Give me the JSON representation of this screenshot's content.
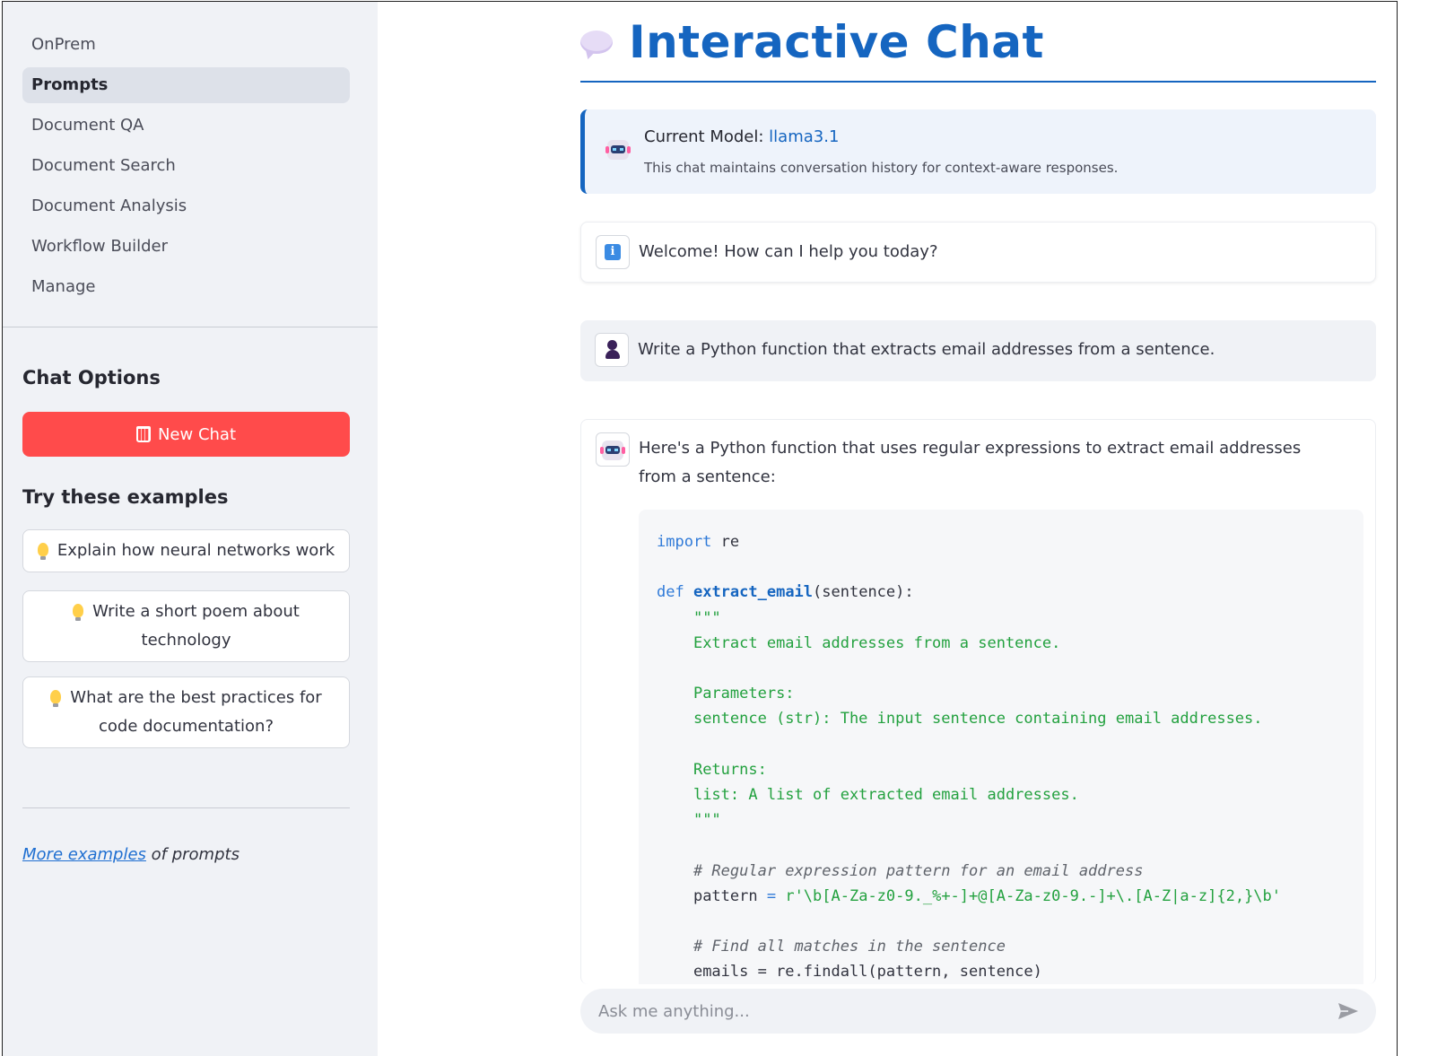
{
  "sidebar": {
    "nav": [
      {
        "label": "OnPrem",
        "active": false
      },
      {
        "label": "Prompts",
        "active": true
      },
      {
        "label": "Document QA",
        "active": false
      },
      {
        "label": "Document Search",
        "active": false
      },
      {
        "label": "Document Analysis",
        "active": false
      },
      {
        "label": "Workflow Builder",
        "active": false
      },
      {
        "label": "Manage",
        "active": false
      }
    ],
    "chat_options_heading": "Chat Options",
    "new_chat_label": "New Chat",
    "examples_heading": "Try these examples",
    "examples": [
      "Explain how neural networks work",
      "Write a short poem about technology",
      "What are the best practices for code documentation?"
    ],
    "more_link": "More examples",
    "more_suffix": " of prompts"
  },
  "main": {
    "title": "Interactive Chat",
    "model_label": "Current Model: ",
    "model_name": "llama3.1",
    "model_subtitle": "This chat maintains conversation history for context-aware responses.",
    "messages": {
      "welcome": "Welcome! How can I help you today?",
      "user": "Write a Python function that extracts email addresses from a sentence.",
      "assistant": "Here's a Python function that uses regular expressions to extract email addresses from a sentence:"
    },
    "code": {
      "l1_kw": "import",
      "l1_rest": " re",
      "l2_kw": "def",
      "l2_fn": "extract_email",
      "l2_rest": "(sentence):",
      "doc_open": "\"\"\"",
      "doc_1": "Extract email addresses from a sentence.",
      "doc_2": "Parameters:",
      "doc_3": "sentence (str): The input sentence containing email addresses.",
      "doc_4": "Returns:",
      "doc_5": "list: A list of extracted email addresses.",
      "doc_close": "\"\"\"",
      "comment_1": "# Regular expression pattern for an email address",
      "pattern_lhs": "pattern",
      "pattern_eq": " = ",
      "pattern_val": "r'\\b[A-Za-z0-9._%+-]+@[A-Za-z0-9.-]+\\.[A-Z|a-z]{2,}\\b'",
      "comment_2": "# Find all matches in the sentence",
      "last_line": "emails = re.findall(pattern, sentence)"
    },
    "input_placeholder": "Ask me anything..."
  },
  "colors": {
    "accent": "#1565c0",
    "new_chat_button": "#ff4b4b",
    "sidebar_bg": "#f0f2f6",
    "code_string": "#23a13f"
  },
  "icons": {
    "title": "speech-bubble-icon",
    "model": "robot-icon",
    "welcome": "info-icon",
    "user": "user-icon",
    "assistant": "robot-icon",
    "new_chat": "wastebasket-icon",
    "examples": "lightbulb-icon",
    "send": "send-icon"
  }
}
